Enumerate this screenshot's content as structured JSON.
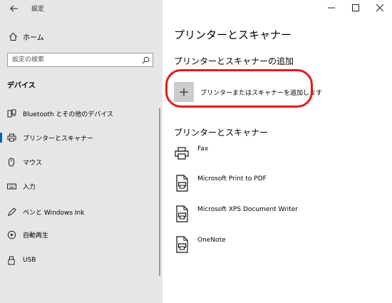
{
  "window": {
    "title": "設定",
    "back_icon": "back-arrow-icon",
    "controls": [
      "minimize-icon",
      "maximize-icon",
      "close-icon"
    ]
  },
  "sidebar": {
    "home_label": "ホーム",
    "search_placeholder": "設定の検索",
    "section_heading": "デバイス",
    "items": [
      {
        "label": "Bluetooth とその他のデバイス",
        "icon": "bluetooth-devices-icon",
        "active": false
      },
      {
        "label": "プリンターとスキャナー",
        "icon": "printer-icon",
        "active": true
      },
      {
        "label": "マウス",
        "icon": "mouse-icon",
        "active": false
      },
      {
        "label": "入力",
        "icon": "keyboard-icon",
        "active": false
      },
      {
        "label": "ペンと Windows Ink",
        "icon": "pen-icon",
        "active": false
      },
      {
        "label": "自動再生",
        "icon": "autoplay-icon",
        "active": false
      },
      {
        "label": "USB",
        "icon": "usb-icon",
        "active": false
      }
    ]
  },
  "main": {
    "title": "プリンターとスキャナー",
    "add_section_heading": "プリンターとスキャナーの追加",
    "add_button_label": "プリンターまたはスキャナーを追加します",
    "add_button_symbol": "+",
    "list_heading": "プリンターとスキャナー",
    "devices": [
      {
        "name": "Fax",
        "icon": "fax-printer-icon"
      },
      {
        "name": "Microsoft Print to PDF",
        "icon": "document-printer-icon"
      },
      {
        "name": "Microsoft XPS Document Writer",
        "icon": "document-printer-icon"
      },
      {
        "name": "OneNote",
        "icon": "document-printer-icon"
      }
    ]
  },
  "colors": {
    "sidebar_bg": "#e6e6e6",
    "accent": "#0063b1",
    "highlight_annotation": "#e31b1b"
  }
}
